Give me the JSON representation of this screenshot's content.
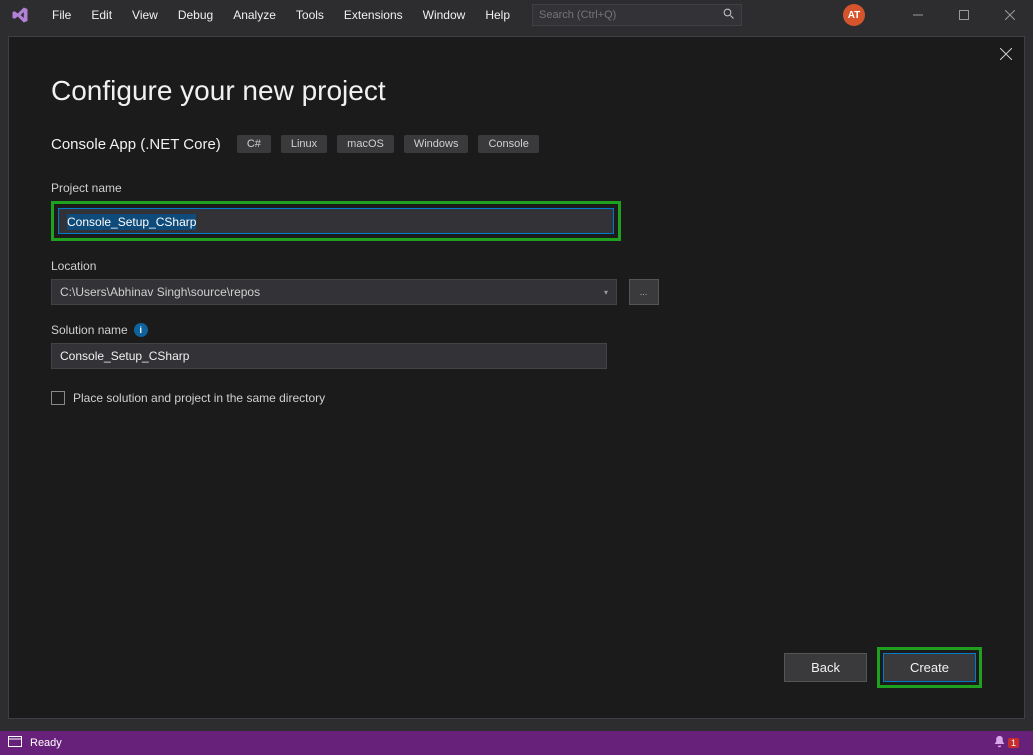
{
  "menu": [
    "File",
    "Edit",
    "View",
    "Debug",
    "Analyze",
    "Tools",
    "Extensions",
    "Window",
    "Help"
  ],
  "search": {
    "placeholder": "Search (Ctrl+Q)"
  },
  "avatar": "AT",
  "dialog": {
    "title": "Configure your new project",
    "subtitle": "Console App (.NET Core)",
    "tags": [
      "C#",
      "Linux",
      "macOS",
      "Windows",
      "Console"
    ],
    "project_name_label": "Project name",
    "project_name_value": "Console_Setup_CSharp",
    "location_label": "Location",
    "location_value": "C:\\Users\\Abhinav Singh\\source\\repos",
    "browse_label": "…",
    "solution_name_label": "Solution name",
    "solution_name_value": "Console_Setup_CSharp",
    "checkbox_label": "Place solution and project in the same directory",
    "back_label": "Back",
    "create_label": "Create"
  },
  "status": {
    "ready": "Ready",
    "notif_count": "1"
  }
}
